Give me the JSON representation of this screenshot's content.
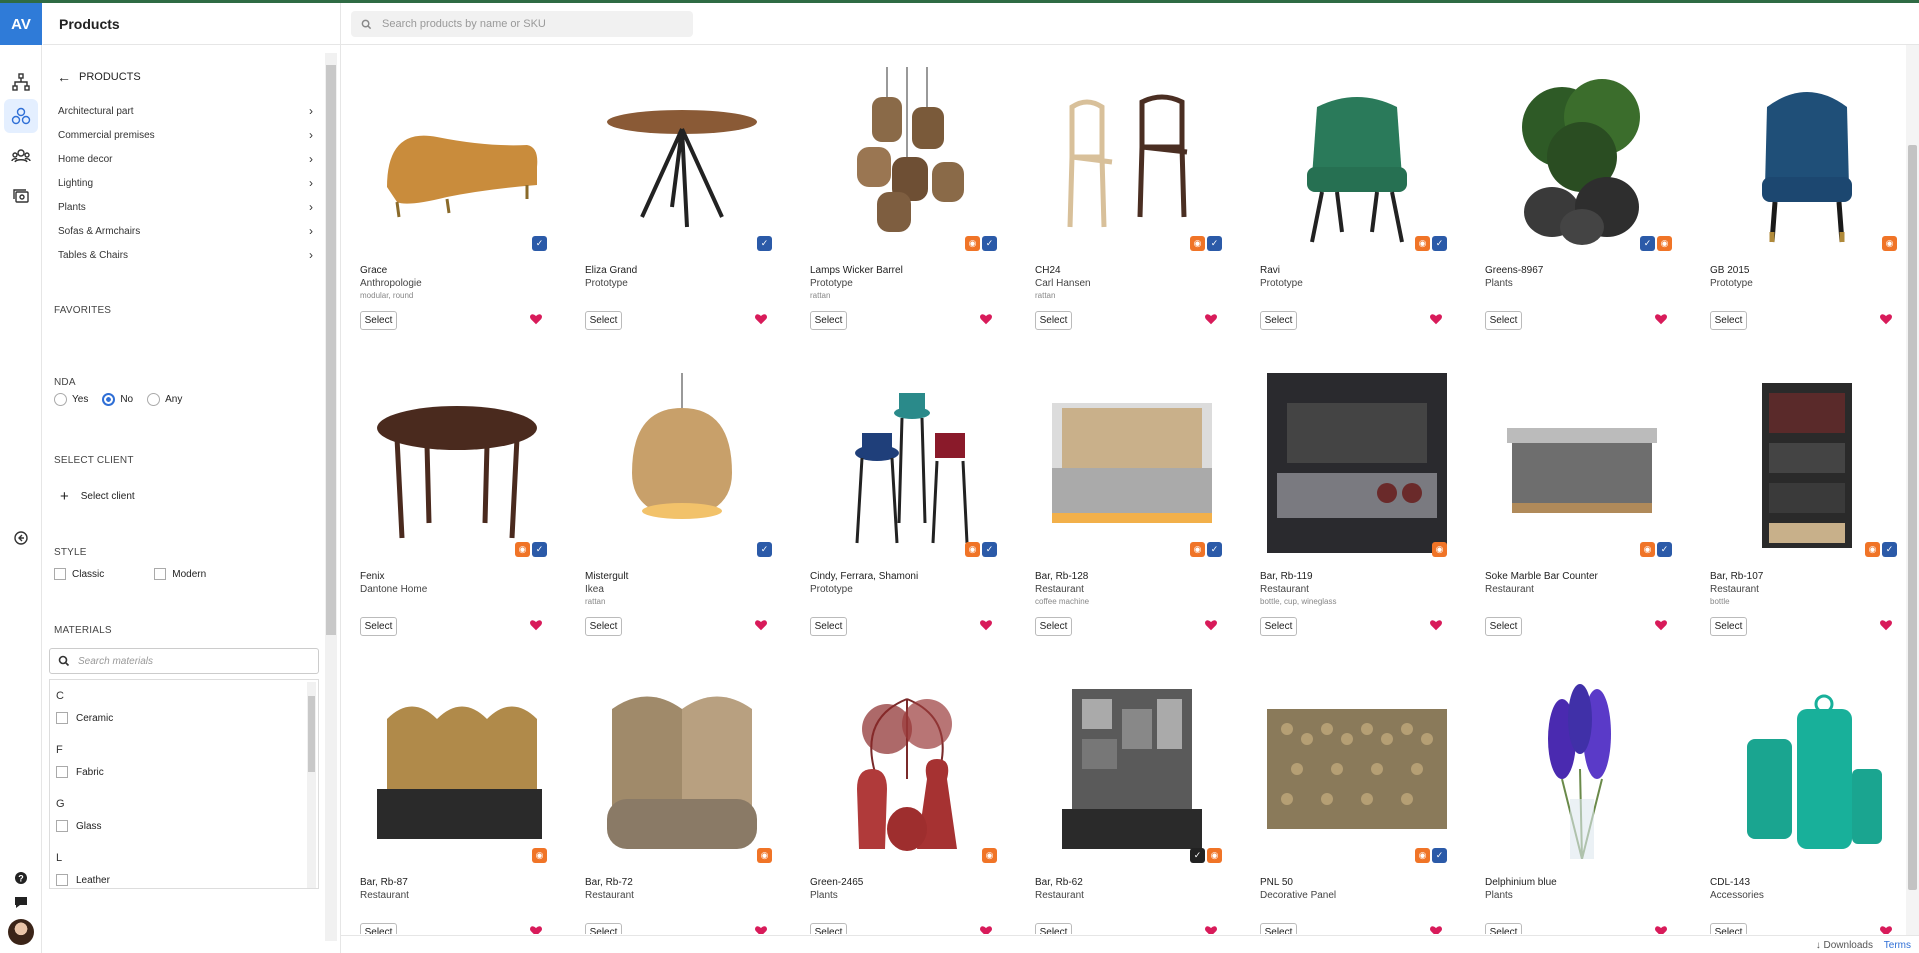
{
  "app": {
    "logo": "AV",
    "title": "Products",
    "search_placeholder": "Search products by name or SKU",
    "footer_downloads": "↓ Downloads",
    "footer_terms": "Terms"
  },
  "sidebar": {
    "back_label": "PRODUCTS",
    "categories": [
      "Architectural part",
      "Commercial premises",
      "Home decor",
      "Lighting",
      "Plants",
      "Sofas & Armchairs",
      "Tables & Chairs"
    ],
    "favorites_title": "FAVORITES",
    "nda_title": "NDA",
    "nda_options": [
      "Yes",
      "No",
      "Any"
    ],
    "nda_selected": "No",
    "client_title": "SELECT CLIENT",
    "client_button": "Select client",
    "style_title": "STYLE",
    "style_options": [
      "Classic",
      "Modern"
    ],
    "materials_title": "MATERIALS",
    "materials_placeholder": "Search materials",
    "materials": [
      {
        "letter": "C",
        "item": "Ceramic"
      },
      {
        "letter": "F",
        "item": "Fabric"
      },
      {
        "letter": "G",
        "item": "Glass"
      },
      {
        "letter": "L",
        "item": "Leather"
      }
    ]
  },
  "ui": {
    "select_label": "Select"
  },
  "colors": {
    "accent": "#2f7bd8",
    "heart": "#d81b5a",
    "badge_orange": "#f07427",
    "badge_blue": "#2b5aa8"
  },
  "products": [
    {
      "name": "Grace",
      "sub": "Anthropologie",
      "tags": "modular, round",
      "badges": [
        "b"
      ],
      "img": "sofa"
    },
    {
      "name": "Eliza Grand",
      "sub": "Prototype",
      "tags": "",
      "badges": [
        "b"
      ],
      "img": "table-round"
    },
    {
      "name": "Lamps Wicker Barrel",
      "sub": "Prototype",
      "tags": "rattan",
      "badges": [
        "o",
        "b"
      ],
      "img": "lamps"
    },
    {
      "name": "CH24",
      "sub": "Carl Hansen",
      "tags": "rattan",
      "badges": [
        "o",
        "b"
      ],
      "img": "wishbone"
    },
    {
      "name": "Ravi",
      "sub": "Prototype",
      "tags": "",
      "badges": [
        "o",
        "b"
      ],
      "img": "green-chair"
    },
    {
      "name": "Greens-8967",
      "sub": "Plants",
      "tags": "",
      "badges": [
        "b",
        "o"
      ],
      "img": "plants"
    },
    {
      "name": "GB 2015",
      "sub": "Prototype",
      "tags": "",
      "badges": [
        "o"
      ],
      "img": "blue-chair"
    },
    {
      "name": "Fenix",
      "sub": "Dantone Home",
      "tags": "",
      "badges": [
        "o",
        "b"
      ],
      "img": "dining-table"
    },
    {
      "name": "Mistergult",
      "sub": "Ikea",
      "tags": "rattan",
      "badges": [
        "b"
      ],
      "img": "pendant"
    },
    {
      "name": "Cindy, Ferrara, Shamoni",
      "sub": "Prototype",
      "tags": "",
      "badges": [
        "o",
        "b"
      ],
      "img": "bar-stools"
    },
    {
      "name": "Bar, Rb-128",
      "sub": "Restaurant",
      "tags": "coffee machine",
      "badges": [
        "o",
        "b"
      ],
      "img": "bar-light"
    },
    {
      "name": "Bar, Rb-119",
      "sub": "Restaurant",
      "tags": "bottle, cup, wineglass",
      "badges": [
        "o"
      ],
      "img": "bar-dark"
    },
    {
      "name": "Soke Marble Bar Counter",
      "sub": "Restaurant",
      "tags": "",
      "badges": [
        "o",
        "b"
      ],
      "img": "marble-counter"
    },
    {
      "name": "Bar, Rb-107",
      "sub": "Restaurant",
      "tags": "bottle",
      "badges": [
        "o",
        "b"
      ],
      "img": "wine-shelf"
    },
    {
      "name": "Bar, Rb-87",
      "sub": "Restaurant",
      "tags": "",
      "badges": [
        "o"
      ],
      "img": "arched-bar"
    },
    {
      "name": "Bar, Rb-72",
      "sub": "Restaurant",
      "tags": "",
      "badges": [
        "o"
      ],
      "img": "arch-bar-2"
    },
    {
      "name": "Green-2465",
      "sub": "Plants",
      "tags": "",
      "badges": [
        "o"
      ],
      "img": "vases"
    },
    {
      "name": "Bar, Rb-62",
      "sub": "Restaurant",
      "tags": "",
      "badges": [
        "k",
        "o"
      ],
      "img": "bar-shelves"
    },
    {
      "name": "PNL 50",
      "sub": "Decorative Panel",
      "tags": "",
      "badges": [
        "o",
        "b"
      ],
      "img": "panel"
    },
    {
      "name": "Delphinium blue",
      "sub": "Plants",
      "tags": "",
      "badges": [],
      "img": "delphinium"
    },
    {
      "name": "CDL-143",
      "sub": "Accessories",
      "tags": "",
      "badges": [],
      "img": "lanterns"
    }
  ]
}
